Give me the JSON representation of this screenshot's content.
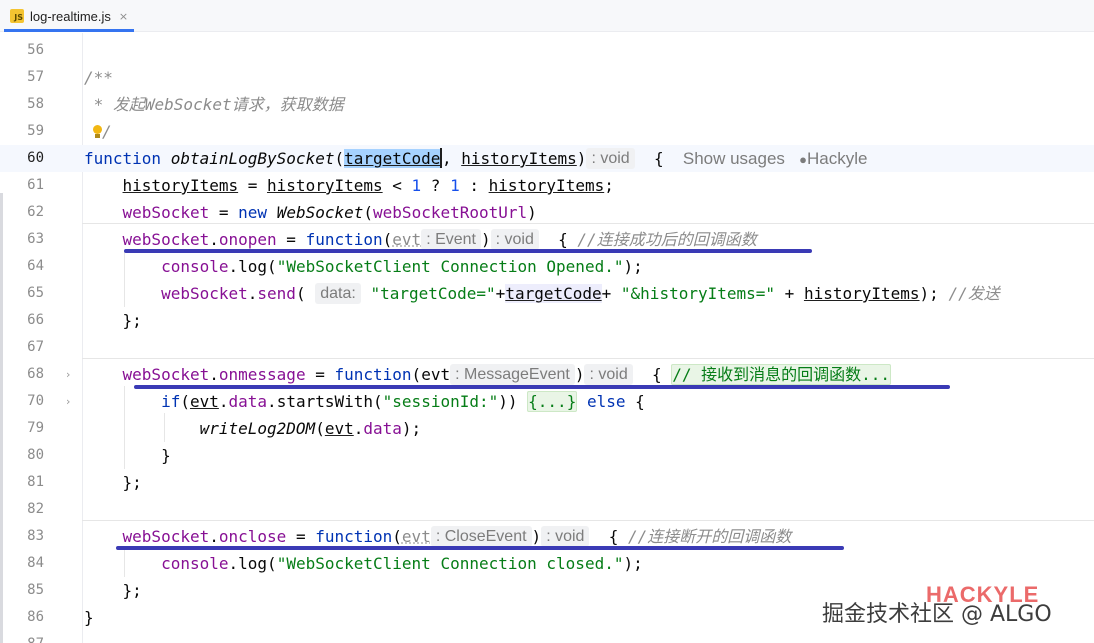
{
  "tab": {
    "icon": "js-file-icon",
    "icon_text": "JS",
    "title": "log-realtime.js",
    "close": "×"
  },
  "lines": {
    "l56": "56",
    "l57": "57",
    "l58": "58",
    "l59": "59",
    "l60": "60",
    "l61": "61",
    "l62": "62",
    "l63": "63",
    "l64": "64",
    "l65": "65",
    "l66": "66",
    "l67": "67",
    "l68": "68",
    "l70": "70",
    "l79": "79",
    "l80": "80",
    "l81": "81",
    "l82": "82",
    "l83": "83",
    "l84": "84",
    "l85": "85",
    "l86": "86",
    "l87": "87"
  },
  "code": {
    "doc_open": "/**",
    "doc_line": " * 发起WebSocket请求，获取数据",
    "doc_close": "/",
    "fn_keyword": "function",
    "fn_name": "obtainLogBySocket",
    "param1": "targetCode",
    "param2": "historyItems",
    "hint_void": ": void",
    "show_usages": "Show usages",
    "author": "Hackyle",
    "history_items": "historyItems",
    "web_socket": "webSocket",
    "new_kw": "new",
    "web_socket_class": "WebSocket",
    "root_url": "webSocketRootUrl",
    "onopen": "onopen",
    "onmessage": "onmessage",
    "onclose": "onclose",
    "evt": "evt",
    "hint_event": ": Event",
    "hint_message_event": ": MessageEvent",
    "hint_close_event": ": CloseEvent",
    "cmt_onopen": "//连接成功后的回调函数",
    "cmt_onmessage": "// 接收到消息的回调函数...",
    "cmt_onclose": "//连接断开的回调函数",
    "cmt_send": "//发送",
    "console": "console",
    "log": "log",
    "str_opened": "\"WebSocketClient Connection Opened.\"",
    "str_closed": "\"WebSocketClient Connection closed.\"",
    "send": "send",
    "hint_data": "data:",
    "str_target_code": "\"targetCode=\"",
    "str_history_items": "\"&historyItems=\"",
    "if_kw": "if",
    "data_prop": "data",
    "starts_with": "startsWith",
    "str_session": "\"sessionId:\"",
    "folded": "{...}",
    "else_kw": "else",
    "write_log": "writeLog2DOM",
    "num_one": "1"
  },
  "watermark": {
    "brand": "HACKYLE",
    "text": "掘金技术社区 @ ALGO"
  },
  "colors": {
    "keyword": "#0033b3",
    "string": "#067d17",
    "property": "#871094",
    "number": "#1750eb",
    "comment": "#8c8c8c",
    "annotation_underline": "#3a3ab5",
    "tab_accent": "#3574f0"
  }
}
